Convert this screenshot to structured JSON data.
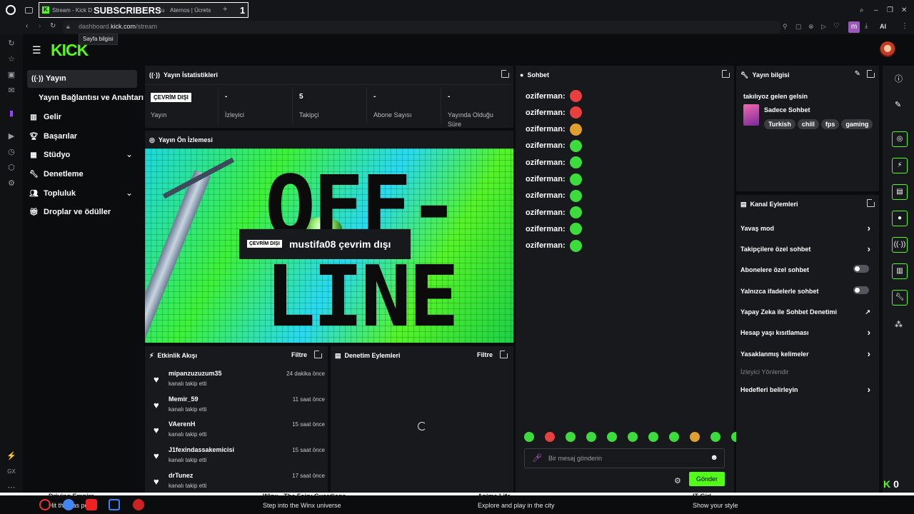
{
  "browser": {
    "tabs": [
      "Stream - Kick D",
      "cu",
      "Aternos | Ücrets"
    ],
    "overlay_label": "SUBSCRIBERS",
    "overlay_count": "1",
    "url_prefix": "dashboard.",
    "url_domain": "kick.com",
    "url_path": "/stream",
    "tooltip": "Sayfa bilgisi",
    "profile_badge": "m",
    "ai_label": "AI"
  },
  "sidebar": {
    "items": [
      {
        "label": "Yayın",
        "icon": "broadcast-icon"
      },
      {
        "label": "Yayın Bağlantısı ve Anahtarı",
        "icon": ""
      },
      {
        "label": "Gelir",
        "icon": "chart-icon"
      },
      {
        "label": "Başarılar",
        "icon": "trophy-icon"
      },
      {
        "label": "Stüdyo",
        "icon": "grid-icon"
      },
      {
        "label": "Denetleme",
        "icon": "wrench-icon"
      },
      {
        "label": "Topluluk",
        "icon": "people-icon"
      },
      {
        "label": "Droplar ve ödüller",
        "icon": "gift-icon"
      }
    ]
  },
  "logo": "KICK",
  "stats": {
    "title": "Yayın İstatistikleri",
    "status_badge": "ÇEVRİM DIŞI",
    "status_label": "Yayın",
    "cells": [
      {
        "value": "-",
        "label": "İzleyici"
      },
      {
        "value": "5",
        "label": "Takipçi"
      },
      {
        "value": "-",
        "label": "Abone Sayısı"
      },
      {
        "value": "-",
        "label": "Yayında Olduğu Süre"
      }
    ]
  },
  "preview": {
    "title": "Yayın Ön İzlemesi",
    "badge": "ÇEVRİM DIŞI",
    "message": "mustifa08 çevrim dışı",
    "big_text_1": "OFF-",
    "big_text_2": "LINE"
  },
  "feed": {
    "title": "Etkinlik Akışı",
    "filter": "Filtre",
    "rows": [
      {
        "user": "mipanzuzuzum35",
        "action": "kanalı takip etti",
        "time": "24 dakika önce"
      },
      {
        "user": "Memir_59",
        "action": "kanalı takip etti",
        "time": "11 saat önce"
      },
      {
        "user": "VAerenH",
        "action": "kanalı takip etti",
        "time": "15 saat önce"
      },
      {
        "user": "J1fexindassakemicisi",
        "action": "kanalı takip etti",
        "time": "15 saat önce"
      },
      {
        "user": "drTunez",
        "action": "kanalı takip etti",
        "time": "17 saat önce"
      }
    ]
  },
  "moderation": {
    "title": "Denetim Eylemleri",
    "filter": "Filtre"
  },
  "chat": {
    "title": "Sohbet",
    "user": "oziferman:",
    "emote_colors": [
      "#e83f3f",
      "#e83f3f",
      "#e0a030",
      "#3ddc3d",
      "#3ddc3d",
      "#3ddc3d",
      "#3ddc3d",
      "#3ddc3d",
      "#3ddc3d",
      "#3ddc3d"
    ],
    "input_placeholder": "Bir mesaj gönderin",
    "send": "Gönder",
    "picker_colors": [
      "#3ddc3d",
      "#e83f3f",
      "#3ddc3d",
      "#3ddc3d",
      "#3ddc3d",
      "#3ddc3d",
      "#3ddc3d",
      "#3ddc3d",
      "#e0a030",
      "#3ddc3d",
      "#3ddc3d"
    ]
  },
  "info": {
    "title": "Yayın bilgisi",
    "stream_title": "takılıyoz gelen gelsin",
    "category": "Sadece Sohbet",
    "tags": [
      "Turkish",
      "chill",
      "fps",
      "gaming"
    ]
  },
  "actions": {
    "title": "Kanal Eylemleri",
    "items": [
      {
        "label": "Yavaş mod",
        "control": "chevron"
      },
      {
        "label": "Takipçilere özel sohbet",
        "control": "chevron"
      },
      {
        "label": "Abonelere özel sohbet",
        "control": "toggle"
      },
      {
        "label": "Yalnızca ifadelerle sohbet",
        "control": "toggle"
      },
      {
        "label": "Yapay Zeka ile Sohbet Denetimi",
        "control": "external"
      },
      {
        "label": "Hesap yaşı kısıtlaması",
        "control": "chevron"
      },
      {
        "label": "Yasaklanmış kelimeler",
        "control": "chevron"
      },
      {
        "label": "İzleyici Yönlendir",
        "control": "disabled"
      },
      {
        "label": "Hedefleri belirleyin",
        "control": "chevron"
      }
    ]
  },
  "corner_counter": "0",
  "bottom_bar": [
    {
      "title": "Driving Empire",
      "sub": "Hit the gas pedal"
    },
    {
      "title": "Winx - The Fairy Guardians",
      "sub": "Step into the Winx universe"
    },
    {
      "title": "Anime Life",
      "sub": "Explore and play in the city"
    },
    {
      "title": "IT Girl",
      "sub": "Show your style"
    }
  ],
  "colors": {
    "accent": "#53fc18",
    "panel": "#18191c",
    "bg": "#0b0c0e"
  }
}
